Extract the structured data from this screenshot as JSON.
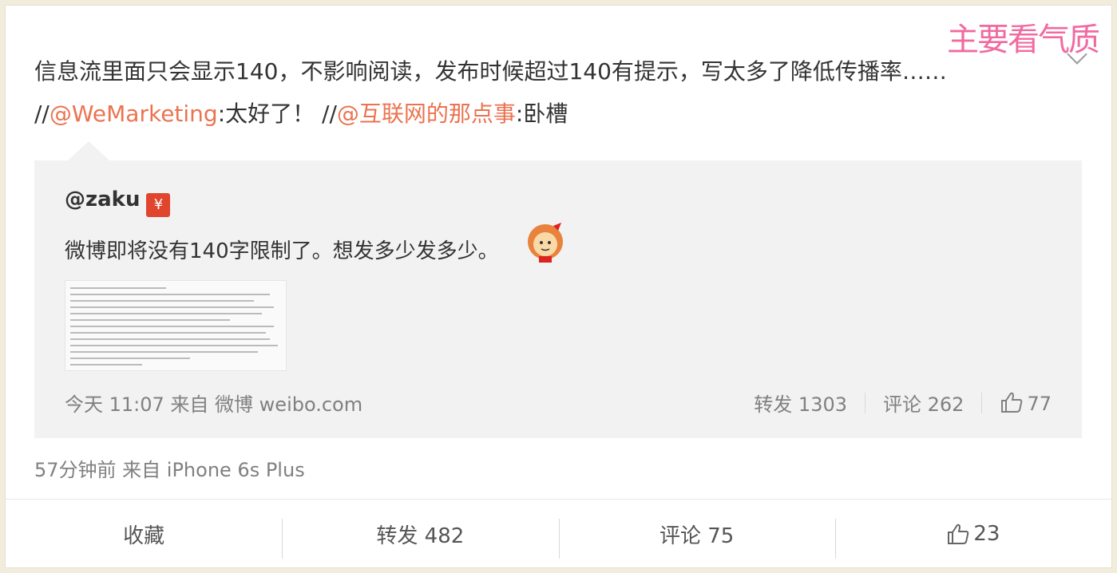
{
  "badge_text": "主要看气质",
  "post": {
    "text_main": "信息流里面只会显示140，不影响阅读，发布时候超过140有提示，写太多了降低传播率…… //",
    "mention1": "@WeMarketing",
    "text_after1": ":太好了！ //",
    "mention2": "@互联网的那点事",
    "text_after2": ":卧槽",
    "meta": "57分钟前 来自 iPhone 6s Plus"
  },
  "repost": {
    "user": "@zaku",
    "hongbao_icon": "¥",
    "text": "微博即将没有140字限制了。想发多少发多少。",
    "meta": "今天 11:07 来自 微博 weibo.com",
    "forward": "转发 1303",
    "comment": "评论 262",
    "like": "77"
  },
  "footer": {
    "favorite": "收藏",
    "forward": "转发 482",
    "comment": "评论 75",
    "like": "23"
  },
  "colors": {
    "mention": "#eb7350",
    "badge": "#f06ba0"
  },
  "icons": [
    "chevron-down-icon",
    "hongbao-icon",
    "monkey-emoji-icon",
    "thumbs-up-icon"
  ]
}
